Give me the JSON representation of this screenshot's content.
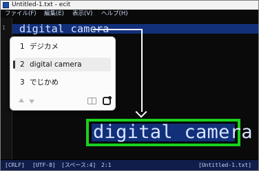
{
  "window": {
    "title": "Untitled-1.txt - ecit"
  },
  "menu": [
    "ファイル(F)",
    "編集(E)",
    "表示(V)",
    "ヘルプ(H)"
  ],
  "editor": {
    "line_number": "1",
    "line_text": "digital camera"
  },
  "ime": {
    "candidates": [
      {
        "num": "1",
        "text": "デジカメ"
      },
      {
        "num": "2",
        "text": "digital camera"
      },
      {
        "num": "3",
        "text": "でじかめ"
      }
    ],
    "selected_index": 2
  },
  "zoom": {
    "text": "digital camera"
  },
  "status": {
    "eol": "[CRLF]",
    "enc": "[UTF-8]",
    "space": "[スペース:4]",
    "pos": "2:1",
    "file": "[Untitled-1.txt]"
  },
  "colors": {
    "highlight": "#12307a",
    "zoom_border": "#19d11e"
  }
}
